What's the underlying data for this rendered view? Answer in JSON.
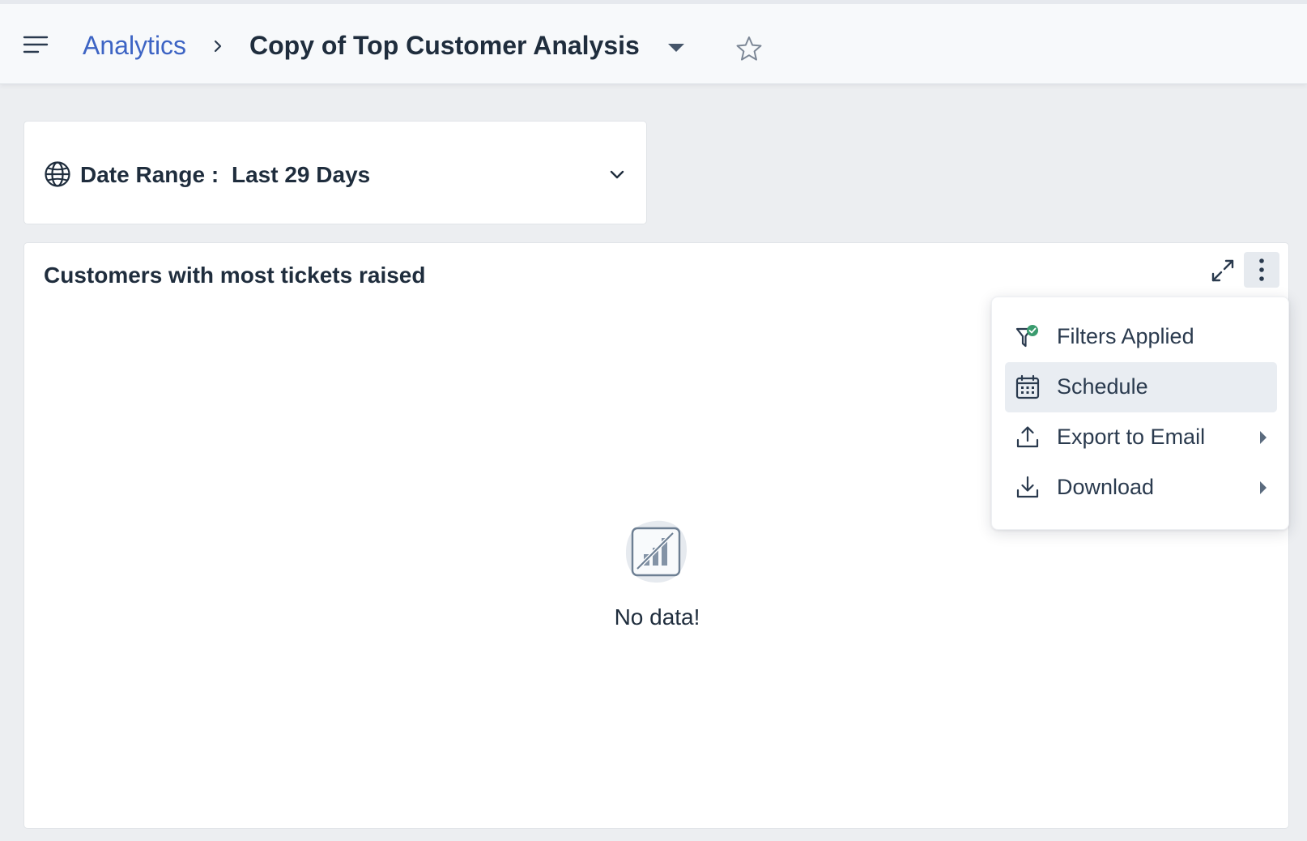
{
  "header": {
    "breadcrumb_root": "Analytics",
    "title": "Copy of Top Customer Analysis",
    "icons": [
      "hamburger-icon",
      "chevron-right-icon",
      "caret-down-icon",
      "star-icon"
    ]
  },
  "filter": {
    "label": "Date Range :",
    "value": "Last 29 Days",
    "icons": [
      "globe-icon",
      "chevron-down-icon"
    ]
  },
  "widget": {
    "title": "Customers with most tickets raised",
    "empty_text": "No data!",
    "icons": [
      "expand-icon",
      "more-vertical-icon",
      "no-chart-data-icon"
    ]
  },
  "menu": {
    "items": [
      {
        "label": "Filters Applied",
        "icon": "filter-check-icon",
        "submenu": false,
        "active": false
      },
      {
        "label": "Schedule",
        "icon": "calendar-icon",
        "submenu": false,
        "active": true
      },
      {
        "label": "Export to Email",
        "icon": "upload-icon",
        "submenu": true,
        "active": false
      },
      {
        "label": "Download",
        "icon": "download-icon",
        "submenu": true,
        "active": false
      }
    ]
  },
  "colors": {
    "accent": "#3d64c4",
    "text": "#1f2d3d",
    "background": "#eceef1",
    "check_badge": "#3a9b6e"
  }
}
